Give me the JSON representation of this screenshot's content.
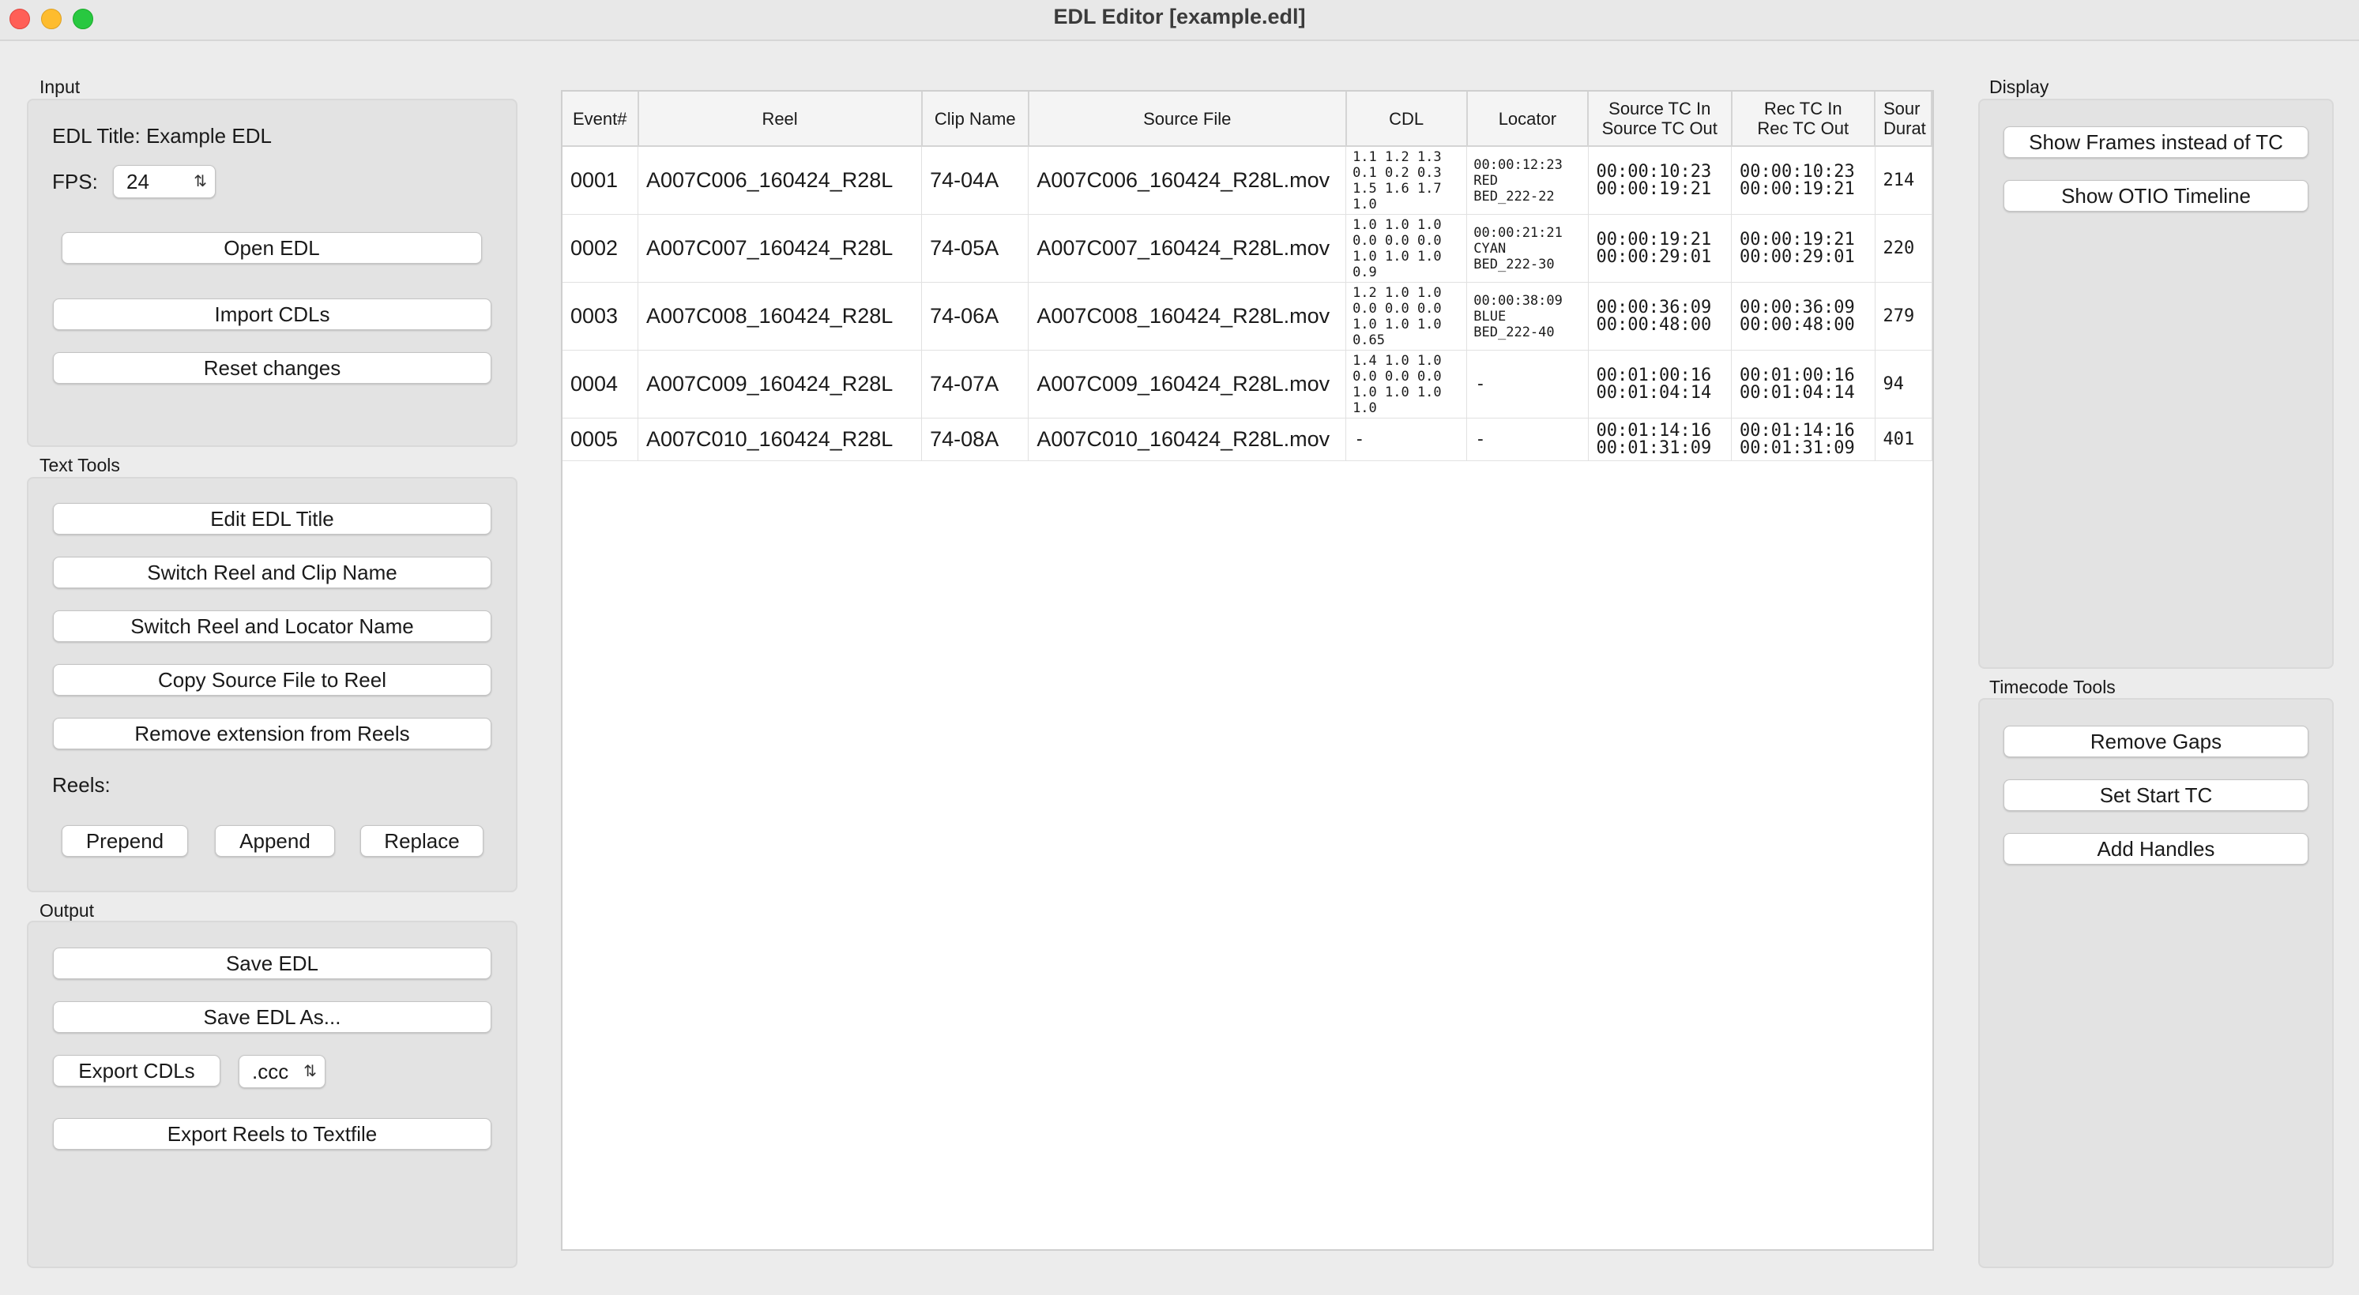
{
  "window": {
    "title": "EDL Editor [example.edl]"
  },
  "input": {
    "label": "Input",
    "edl_title": "EDL Title: Example EDL",
    "fps_label": "FPS:",
    "fps_value": "24",
    "open_edl": "Open EDL",
    "import_cdls": "Import CDLs",
    "reset_changes": "Reset changes"
  },
  "text_tools": {
    "label": "Text Tools",
    "edit_title": "Edit EDL Title",
    "switch_reel_clip": "Switch Reel and Clip Name",
    "switch_reel_locator": "Switch Reel and Locator Name",
    "copy_source_file": "Copy Source File to Reel",
    "remove_extension": "Remove extension from Reels",
    "reels_label": "Reels:",
    "prepend": "Prepend",
    "append": "Append",
    "replace": "Replace"
  },
  "output": {
    "label": "Output",
    "save_edl": "Save EDL",
    "save_edl_as": "Save EDL As...",
    "export_cdls": "Export CDLs",
    "cdl_format": ".ccc",
    "export_reels": "Export Reels to Textfile"
  },
  "display": {
    "label": "Display",
    "show_frames": "Show Frames instead of TC",
    "show_otio": "Show OTIO Timeline"
  },
  "timecode_tools": {
    "label": "Timecode Tools",
    "remove_gaps": "Remove Gaps",
    "set_start_tc": "Set Start TC",
    "add_handles": "Add Handles"
  },
  "table": {
    "headers": {
      "event": "Event#",
      "reel": "Reel",
      "clip_name": "Clip Name",
      "source_file": "Source File",
      "cdl": "CDL",
      "locator": "Locator",
      "source_tc_in": "Source TC In",
      "source_tc_out": "Source TC Out",
      "rec_tc_in": "Rec TC In",
      "rec_tc_out": "Rec TC Out",
      "source_duration_1": "Sour",
      "source_duration_2": "Durat"
    },
    "rows": [
      {
        "event": "0001",
        "reel": "A007C006_160424_R28L",
        "clip_name": "74-04A",
        "source_file": "A007C006_160424_R28L.mov",
        "cdl": "1.1 1.2 1.3\n0.1 0.2 0.3\n1.5 1.6 1.7\n1.0",
        "locator": "00:00:12:23\nRED\nBED_222-22",
        "src_in": "00:00:10:23",
        "src_out": "00:00:19:21",
        "rec_in": "00:00:10:23",
        "rec_out": "00:00:19:21",
        "duration": "214"
      },
      {
        "event": "0002",
        "reel": "A007C007_160424_R28L",
        "clip_name": "74-05A",
        "source_file": "A007C007_160424_R28L.mov",
        "cdl": "1.0 1.0 1.0\n0.0 0.0 0.0\n1.0 1.0 1.0\n0.9",
        "locator": "00:00:21:21\nCYAN\nBED_222-30",
        "src_in": "00:00:19:21",
        "src_out": "00:00:29:01",
        "rec_in": "00:00:19:21",
        "rec_out": "00:00:29:01",
        "duration": "220"
      },
      {
        "event": "0003",
        "reel": "A007C008_160424_R28L",
        "clip_name": "74-06A",
        "source_file": "A007C008_160424_R28L.mov",
        "cdl": "1.2 1.0 1.0\n0.0 0.0 0.0\n1.0 1.0 1.0\n0.65",
        "locator": "00:00:38:09\nBLUE\nBED_222-40",
        "src_in": "00:00:36:09",
        "src_out": "00:00:48:00",
        "rec_in": "00:00:36:09",
        "rec_out": "00:00:48:00",
        "duration": "279"
      },
      {
        "event": "0004",
        "reel": "A007C009_160424_R28L",
        "clip_name": "74-07A",
        "source_file": "A007C009_160424_R28L.mov",
        "cdl": "1.4 1.0 1.0\n0.0 0.0 0.0\n1.0 1.0 1.0\n1.0",
        "locator": "-",
        "src_in": "00:01:00:16",
        "src_out": "00:01:04:14",
        "rec_in": "00:01:00:16",
        "rec_out": "00:01:04:14",
        "duration": "94"
      },
      {
        "event": "0005",
        "reel": "A007C010_160424_R28L",
        "clip_name": "74-08A",
        "source_file": "A007C010_160424_R28L.mov",
        "cdl": "-",
        "locator": "-",
        "src_in": "00:01:14:16",
        "src_out": "00:01:31:09",
        "rec_in": "00:01:14:16",
        "rec_out": "00:01:31:09",
        "duration": "401"
      }
    ]
  }
}
